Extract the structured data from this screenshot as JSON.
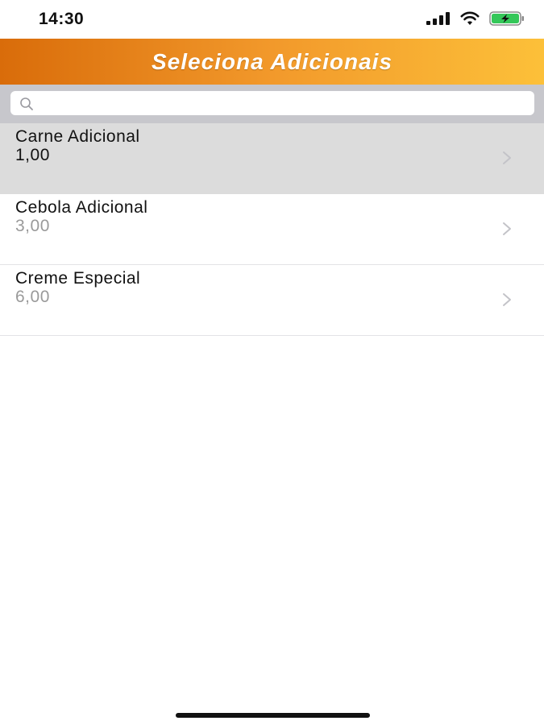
{
  "status_bar": {
    "time": "14:30",
    "icons": [
      "cellular-signal-icon",
      "wifi-icon",
      "battery-charging-icon"
    ],
    "battery_color": "#34c759"
  },
  "nav": {
    "title": "Seleciona Adicionais",
    "gradient_colors": [
      "#d96c0a",
      "#fcc039"
    ]
  },
  "search": {
    "placeholder": "",
    "value": "",
    "icon": "search-icon"
  },
  "items": [
    {
      "name": "Carne Adicional",
      "price": "1,00",
      "selected": true,
      "icon": "chevron-right-icon"
    },
    {
      "name": "Cebola Adicional",
      "price": "3,00",
      "selected": false,
      "icon": "chevron-right-icon"
    },
    {
      "name": "Creme Especial",
      "price": "6,00",
      "selected": false,
      "icon": "chevron-right-icon"
    }
  ]
}
